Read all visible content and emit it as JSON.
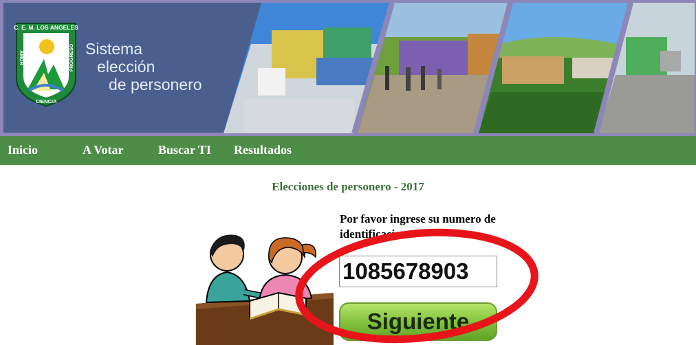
{
  "header": {
    "logo": {
      "top_text": "C. E. M. LOS ANGELES",
      "left_text": "AMOR",
      "right_text": "PROGRESO",
      "bottom_text": "CIENCIA"
    },
    "title_line1": "Sistema",
    "title_line2": "elección",
    "title_line3": "de personero"
  },
  "nav": {
    "items": [
      {
        "label": "Inicio"
      },
      {
        "label": "A Votar"
      },
      {
        "label": "Buscar TI"
      },
      {
        "label": "Resultados"
      }
    ]
  },
  "main": {
    "title": "Elecciones de personero - 2017",
    "prompt": "Por favor ingrese su numero de identificacion:",
    "id_value": "1085678903",
    "next_label": "Siguiente"
  },
  "colors": {
    "banner_bg": "#8d86b8",
    "banner_panel": "#4b5f8f",
    "nav_bg": "#4e8d48",
    "title_green": "#3c6e3a",
    "highlight_red": "#e8141a",
    "button_green": "#7fc13a"
  }
}
